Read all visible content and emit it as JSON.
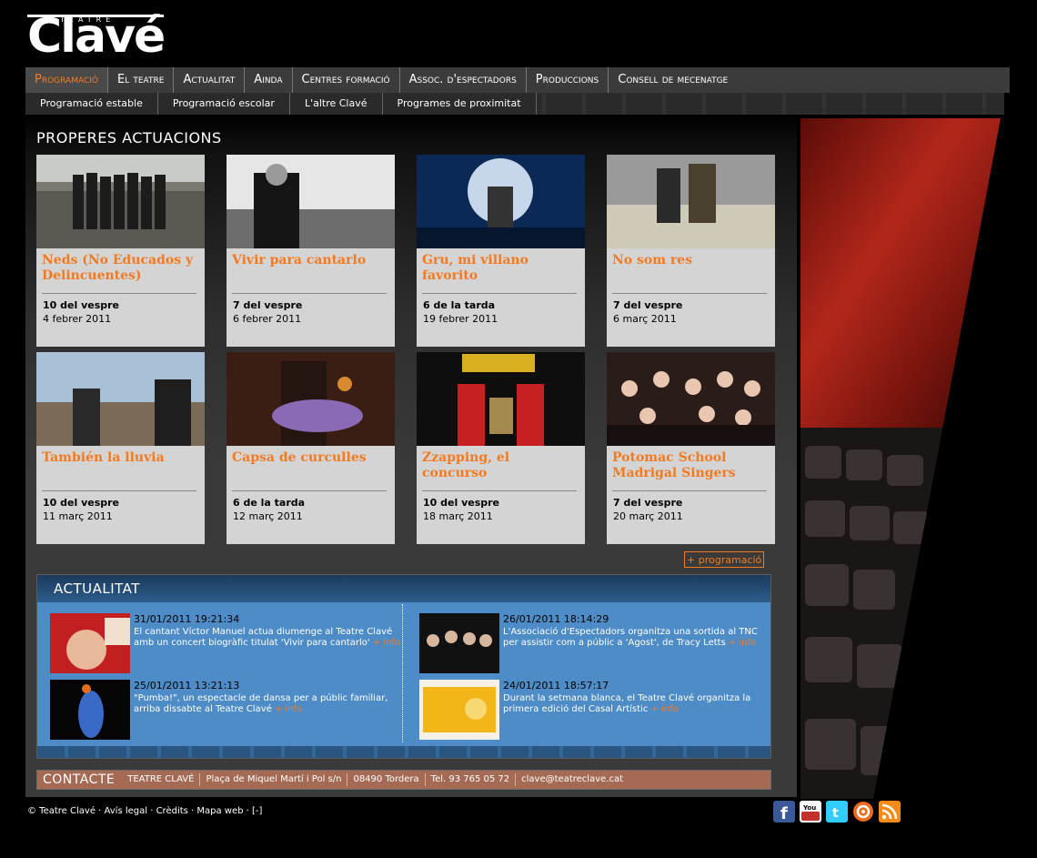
{
  "header": {
    "logo_small": "TEATRE",
    "logo_big": "Clavé"
  },
  "mainnav": [
    "Programació",
    "El teatre",
    "Actualitat",
    "Ainda",
    "Centres formació",
    "Assoc. d'espectadors",
    "Produccions",
    "Consell de mecenatge"
  ],
  "subnav": [
    "Programació estable",
    "Programació escolar",
    "L'altre Clavé",
    "Programes de proximitat"
  ],
  "section_title": "PROPERES ACTUACIONS",
  "shows": [
    {
      "title": "Neds (No Educados y Delincuentes)",
      "time": "10 del vespre",
      "date": "4 febrer 2011"
    },
    {
      "title": "Vivir para cantarlo",
      "time": "7 del vespre",
      "date": "6 febrer 2011"
    },
    {
      "title": "Gru, mi villano favorito",
      "time": "6 de la tarda",
      "date": "19 febrer 2011"
    },
    {
      "title": "No som res",
      "time": "7 del vespre",
      "date": "6 març 2011"
    },
    {
      "title": "También la lluvia",
      "time": "10 del vespre",
      "date": "11 març 2011"
    },
    {
      "title": "Capsa de curculles",
      "time": "6 de la tarda",
      "date": "12 març 2011"
    },
    {
      "title": "Zzapping, el concurso",
      "time": "10 del vespre",
      "date": "18 març 2011"
    },
    {
      "title": "Potomac School Madrigal Singers",
      "time": "7 del vespre",
      "date": "20 març 2011"
    }
  ],
  "more_programacio": "+ programació",
  "news": {
    "title": "ACTUALITAT",
    "info_label": "+ info",
    "items": [
      {
        "date": "31/01/2011 19:21:34",
        "text": "El cantant Víctor Manuel actua diumenge al Teatre Clavé amb un concert biogràfic titulat 'Vivir para cantarlo'"
      },
      {
        "date": "26/01/2011 18:14:29",
        "text": "L'Associació d'Espectadors organitza una sortida al TNC per assistir com a públic a 'Agost', de Tracy Letts"
      },
      {
        "date": "25/01/2011 13:21:13",
        "text": "\"Pumba!\", un espectacle de dansa per a públic familiar, arriba dissabte al Teatre Clavé"
      },
      {
        "date": "24/01/2011 18:57:17",
        "text": "Durant la setmana blanca, el Teatre Clavé organitza la primera edició del Casal Artístic"
      }
    ]
  },
  "contact": {
    "label": "CONTACTE",
    "cells": [
      "TEATRE CLAVÉ",
      "Plaça de Miquel Martí i Pol s/n",
      "08490 Tordera",
      "Tel. 93 765 05 72",
      "clave@teatreclave.cat"
    ]
  },
  "footer": "© Teatre Clavé · Avís legal · Crèdits · Mapa web · [-]",
  "social_icons": [
    "facebook-icon",
    "youtube-icon",
    "twitter-icon",
    "podcast-icon",
    "rss-icon"
  ],
  "colors": {
    "accent": "#f47a20",
    "news_bg": "#4d8cc6",
    "contact_bg": "#a46a54"
  }
}
